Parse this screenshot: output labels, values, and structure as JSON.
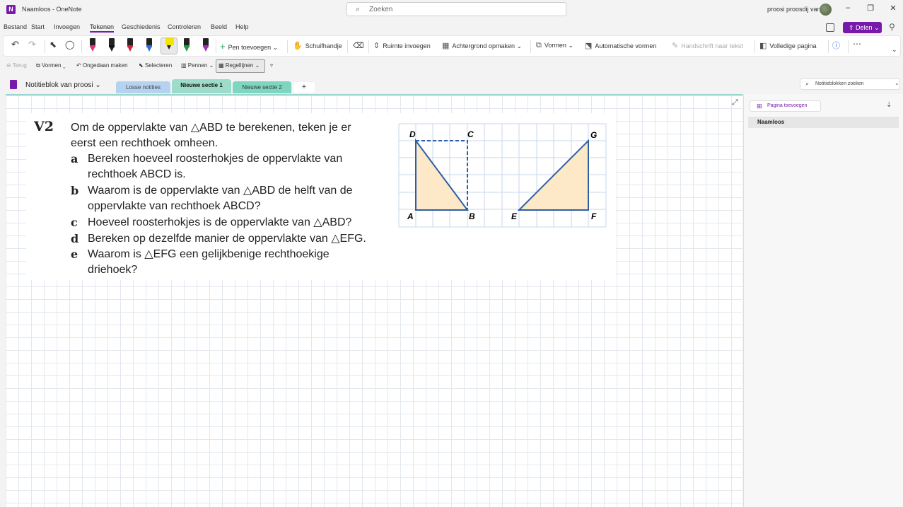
{
  "window": {
    "title": "Naamloos - OneNote",
    "user": "proosi proosdij van"
  },
  "search": {
    "placeholder": "Zoeken"
  },
  "menu": {
    "items": [
      "Bestand",
      "Start",
      "Invoegen",
      "Tekenen",
      "Geschiedenis",
      "Controleren",
      "Beeld",
      "Help"
    ],
    "active": "Tekenen",
    "share_label": "Delen"
  },
  "ribbon": {
    "pen_colors": [
      "#e0327a",
      "#111111",
      "#d0223b",
      "#2e6fd8",
      "#f5e400",
      "#1e9c3a",
      "#9b2fae"
    ],
    "add_pen": "Pen toevoegen",
    "scroll": "Schuifhandje",
    "insert_space": "Ruimte invoegen",
    "background": "Achtergrond opmaken",
    "shapes": "Vormen",
    "auto_shapes": "Automatische vormen",
    "ink_to_text": "Handschrift naar tekst",
    "full_page": "Volledige pagina"
  },
  "qat": {
    "back": "Terug",
    "shapes": "Vormen",
    "undo": "Ongedaan maken",
    "select": "Selecteren",
    "pens": "Pennen",
    "rulelines": "Regellijnen"
  },
  "notebook": {
    "title": "Notitieblok van proosi",
    "tabs": [
      {
        "label": "Losse notities",
        "color": "#b5d3f0",
        "active": false
      },
      {
        "label": "Nieuwe sectie 1",
        "color": "#9ddcc8",
        "active": true
      },
      {
        "label": "Nieuwe sectie 2",
        "color": "#7fd6c0",
        "active": false
      }
    ],
    "search_placeholder": "Notitieblokken zoeken"
  },
  "pages": {
    "add_label": "Pagina toevoegen",
    "items": [
      "Naamloos"
    ]
  },
  "exercise": {
    "number": "V2",
    "intro_1": "Om de oppervlakte van △ABD te berekenen, teken je er",
    "intro_2": "eerst een rechthoek omheen.",
    "a_label": "a",
    "a_1": "Bereken hoeveel roosterhokjes de oppervlakte van",
    "a_2": "rechthoek ABCD is.",
    "b_label": "b",
    "b_1": "Waarom is de oppervlakte van △ABD de helft van de",
    "b_2": "oppervlakte van rechthoek ABCD?",
    "c_label": "c",
    "c_1": "Hoeveel roosterhokjes is de oppervlakte van △ABD?",
    "d_label": "d",
    "d_1": "Bereken op dezelfde manier de oppervlakte van △EFG.",
    "e_label": "e",
    "e_1": "Waarom is △EFG een gelijkbenige rechthoekige",
    "e_2": "driehoek?"
  },
  "figure": {
    "labels": [
      "D",
      "C",
      "A",
      "B",
      "E",
      "F",
      "G"
    ]
  }
}
